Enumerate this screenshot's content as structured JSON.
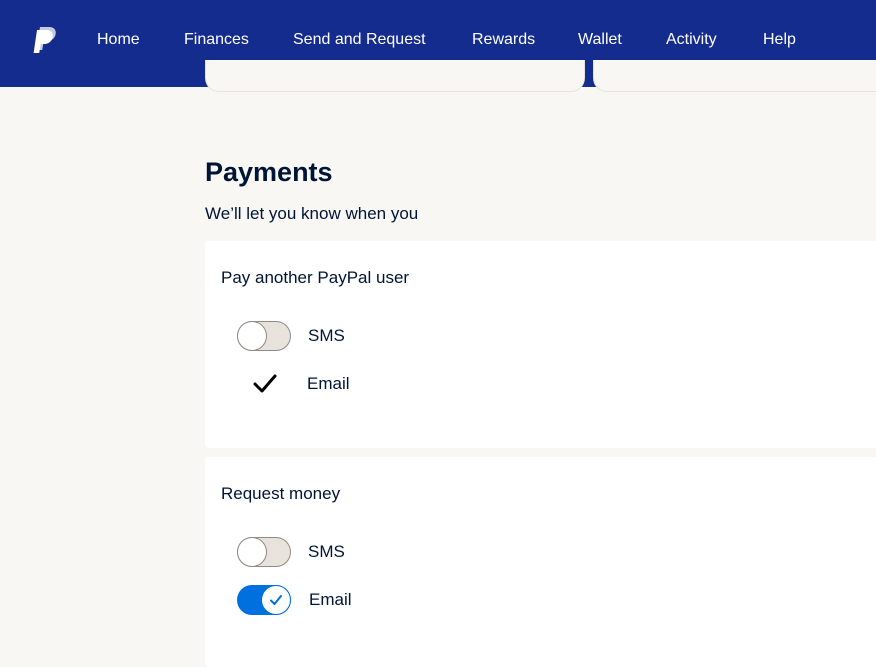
{
  "nav": {
    "logo_icon": "paypal-logo",
    "items": [
      "Home",
      "Finances",
      "Send and Request",
      "Rewards",
      "Wallet",
      "Activity",
      "Help"
    ]
  },
  "section": {
    "title": "Payments",
    "subtitle": "We’ll let you know when you"
  },
  "cards": [
    {
      "title": "Pay another PayPal user",
      "options": [
        {
          "label": "SMS",
          "control": "toggle",
          "state": "off"
        },
        {
          "label": "Email",
          "control": "checkmark",
          "state": "on"
        }
      ]
    },
    {
      "title": "Request money",
      "options": [
        {
          "label": "SMS",
          "control": "toggle",
          "state": "off"
        },
        {
          "label": "Email",
          "control": "toggle",
          "state": "on"
        }
      ]
    }
  ],
  "colors": {
    "nav_bg": "#142c8e",
    "page_bg": "#f8f7f4",
    "toggle_on": "#0070e0",
    "toggle_off": "#e8e3dd",
    "text": "#001435"
  }
}
